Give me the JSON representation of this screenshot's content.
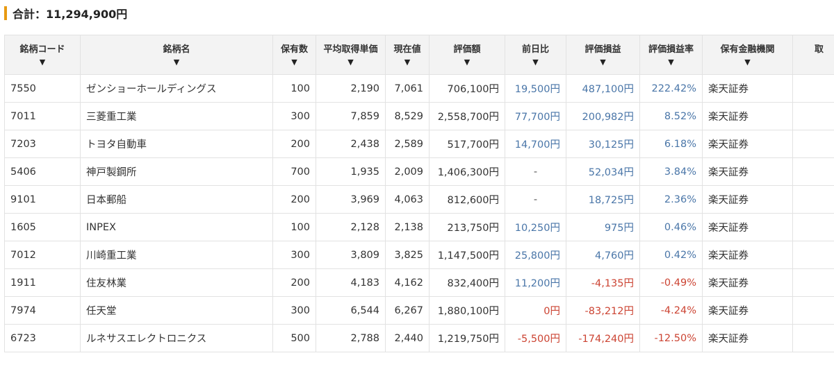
{
  "summary": {
    "total": "合計：11,294,900円"
  },
  "table": {
    "headers": [
      "銘柄コード",
      "銘柄名",
      "保有数",
      "平均取得単価",
      "現在値",
      "評価額",
      "前日比",
      "評価損益",
      "評価損益率",
      "保有金融機関",
      "取"
    ],
    "sort_arrow": "▼",
    "rows": [
      {
        "code": "7550",
        "name": "ゼンショーホールディングス",
        "qty": "100",
        "avg": "2,190",
        "price": "7,061",
        "value": "706,100円",
        "change": "19,500円",
        "gain": "487,100円",
        "rate": "222.42%",
        "broker": "楽天証券",
        "change_sign": "pos",
        "gain_sign": "pos"
      },
      {
        "code": "7011",
        "name": "三菱重工業",
        "qty": "300",
        "avg": "7,859",
        "price": "8,529",
        "value": "2,558,700円",
        "change": "77,700円",
        "gain": "200,982円",
        "rate": "8.52%",
        "broker": "楽天証券",
        "change_sign": "pos",
        "gain_sign": "pos"
      },
      {
        "code": "7203",
        "name": "トヨタ自動車",
        "qty": "200",
        "avg": "2,438",
        "price": "2,589",
        "value": "517,700円",
        "change": "14,700円",
        "gain": "30,125円",
        "rate": "6.18%",
        "broker": "楽天証券",
        "change_sign": "pos",
        "gain_sign": "pos"
      },
      {
        "code": "5406",
        "name": "神戸製鋼所",
        "qty": "700",
        "avg": "1,935",
        "price": "2,009",
        "value": "1,406,300円",
        "change": "-",
        "gain": "52,034円",
        "rate": "3.84%",
        "broker": "楽天証券",
        "change_sign": "neutral",
        "gain_sign": "pos"
      },
      {
        "code": "9101",
        "name": "日本郵船",
        "qty": "200",
        "avg": "3,969",
        "price": "4,063",
        "value": "812,600円",
        "change": "-",
        "gain": "18,725円",
        "rate": "2.36%",
        "broker": "楽天証券",
        "change_sign": "neutral",
        "gain_sign": "pos"
      },
      {
        "code": "1605",
        "name": "INPEX",
        "qty": "100",
        "avg": "2,128",
        "price": "2,138",
        "value": "213,750円",
        "change": "10,250円",
        "gain": "975円",
        "rate": "0.46%",
        "broker": "楽天証券",
        "change_sign": "pos",
        "gain_sign": "pos"
      },
      {
        "code": "7012",
        "name": "川崎重工業",
        "qty": "300",
        "avg": "3,809",
        "price": "3,825",
        "value": "1,147,500円",
        "change": "25,800円",
        "gain": "4,760円",
        "rate": "0.42%",
        "broker": "楽天証券",
        "change_sign": "pos",
        "gain_sign": "pos"
      },
      {
        "code": "1911",
        "name": "住友林業",
        "qty": "200",
        "avg": "4,183",
        "price": "4,162",
        "value": "832,400円",
        "change": "11,200円",
        "gain": "-4,135円",
        "rate": "-0.49%",
        "broker": "楽天証券",
        "change_sign": "pos",
        "gain_sign": "neg"
      },
      {
        "code": "7974",
        "name": "任天堂",
        "qty": "300",
        "avg": "6,544",
        "price": "6,267",
        "value": "1,880,100円",
        "change": "0円",
        "gain": "-83,212円",
        "rate": "-4.24%",
        "broker": "楽天証券",
        "change_sign": "neg",
        "gain_sign": "neg"
      },
      {
        "code": "6723",
        "name": "ルネサスエレクトロニクス",
        "qty": "500",
        "avg": "2,788",
        "price": "2,440",
        "value": "1,219,750円",
        "change": "-5,500円",
        "gain": "-174,240円",
        "rate": "-12.50%",
        "broker": "楽天証券",
        "change_sign": "neg",
        "gain_sign": "neg"
      }
    ]
  },
  "colors": {
    "accent": "#e89a12",
    "positive": "#4a76a8",
    "negative": "#cc4433",
    "header_bg": "#f3f3f3"
  }
}
